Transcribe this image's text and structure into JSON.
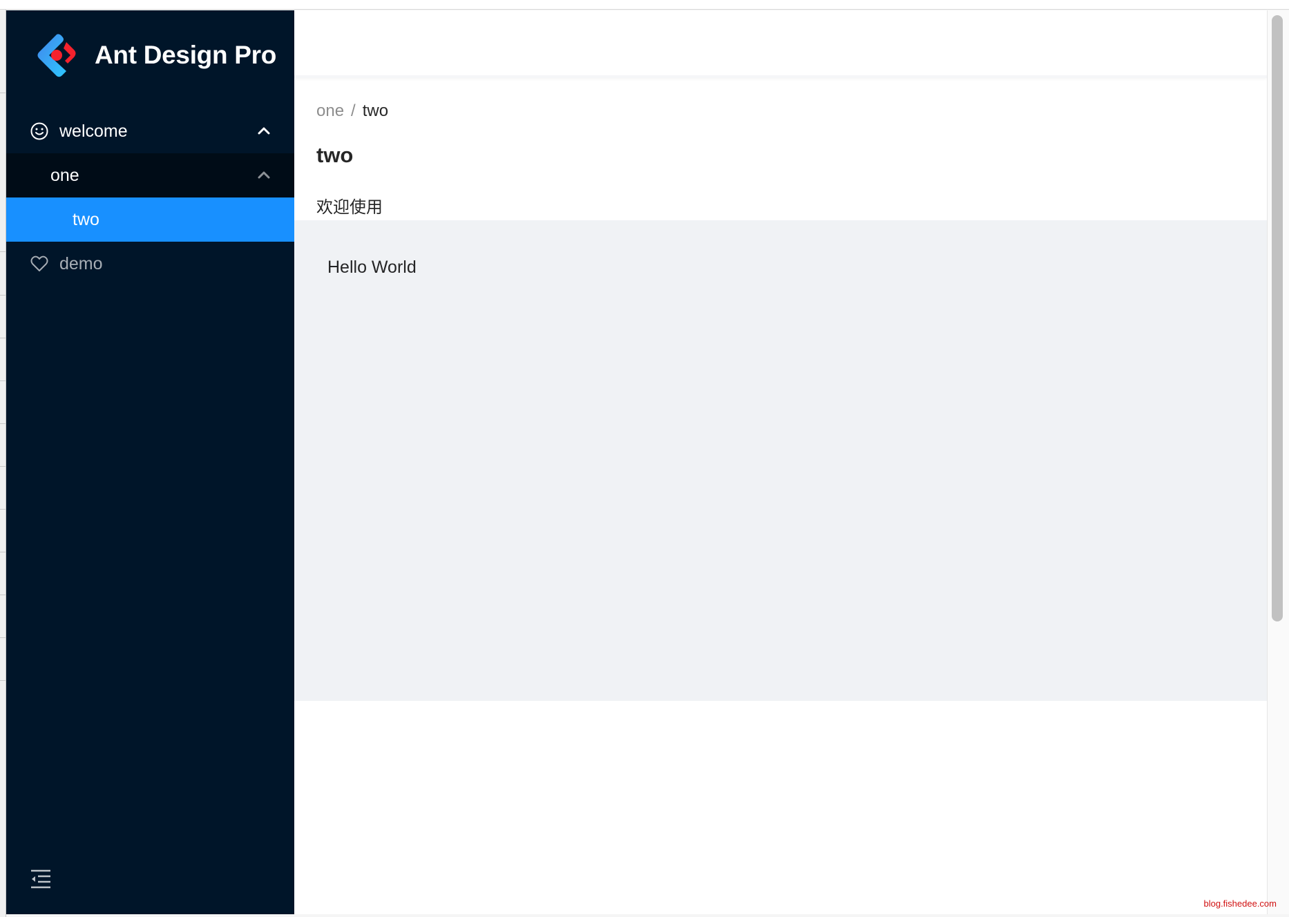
{
  "app": {
    "title": "Ant Design Pro"
  },
  "sidebar": {
    "items": [
      {
        "label": "welcome",
        "icon": "smile-icon",
        "expanded": true,
        "children": [
          {
            "label": "one",
            "expanded": true,
            "children": [
              {
                "label": "two",
                "selected": true
              }
            ]
          }
        ]
      },
      {
        "label": "demo",
        "icon": "heart-icon"
      }
    ],
    "collapse_icon": "menu-fold-icon"
  },
  "breadcrumb": {
    "items": [
      "one",
      "two"
    ],
    "separator": "/"
  },
  "page": {
    "title": "two",
    "description": "欢迎使用"
  },
  "content": {
    "text": "Hello World"
  },
  "watermark": "blog.fishedee.com",
  "colors": {
    "sider_bg": "#001529",
    "submenu_bg": "#000c17",
    "selected_bg": "#1890ff",
    "content_bg": "#f0f2f5"
  }
}
